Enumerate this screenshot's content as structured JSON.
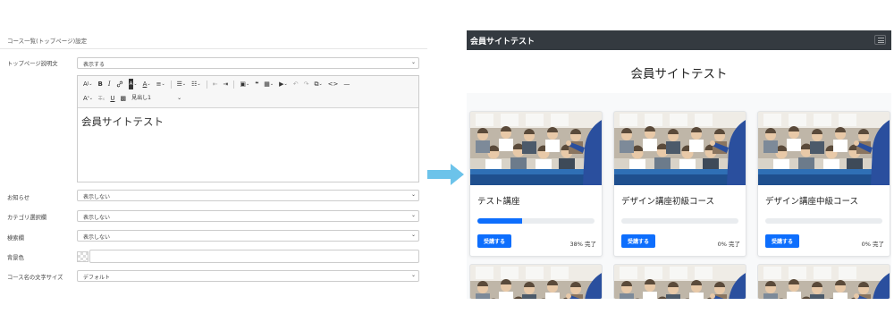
{
  "settings": {
    "section_title": "コース一覧(トップページ)設定",
    "rows": {
      "top_description": {
        "label": "トップページ説明文",
        "value": "表示する"
      },
      "notice": {
        "label": "お知らせ",
        "value": "表示しない"
      },
      "category": {
        "label": "カテゴリ選択欄",
        "value": "表示しない"
      },
      "search": {
        "label": "検索欄",
        "value": "表示しない"
      },
      "bg_color": {
        "label": "背景色",
        "value": ""
      },
      "font_size": {
        "label": "コース名の文字サイズ",
        "value": "デフォルト"
      }
    },
    "editor": {
      "toolbar": {
        "font_size": "A↕",
        "bold": "B",
        "italic": "I",
        "link": "🔗",
        "heading_select": "見出し1",
        "heading_caret": "⌄"
      },
      "content": "会員サイトテスト"
    }
  },
  "preview": {
    "brand": "会員サイトテスト",
    "hero_title": "会員サイトテスト",
    "courses": [
      {
        "title": "テスト講座",
        "progress_percent": 38,
        "progress_text": "38% 完了",
        "button": "受講する"
      },
      {
        "title": "デザイン講座初級コース",
        "progress_percent": 0,
        "progress_text": "0% 完了",
        "button": "受講する"
      },
      {
        "title": "デザイン講座中級コース",
        "progress_percent": 0,
        "progress_text": "0% 完了",
        "button": "受講する"
      }
    ]
  },
  "colors": {
    "accent": "#0d6efd",
    "navbar": "#343a40",
    "arrow": "#6cc3ea"
  }
}
